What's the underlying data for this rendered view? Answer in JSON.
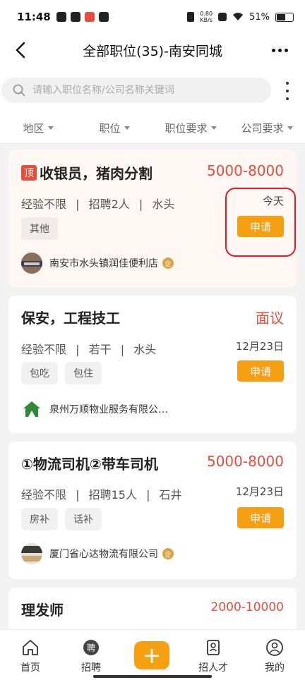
{
  "status_bar": {
    "time": "11:48",
    "net_speed_value": "0.80",
    "net_speed_unit": "KB/s",
    "battery": "51%",
    "battery_level": 0.51
  },
  "header": {
    "title": "全部职位(35)-南安同城"
  },
  "search": {
    "placeholder": "请输入职位名称/公司名称关键词"
  },
  "filters": [
    {
      "label": "地区"
    },
    {
      "label": "职位"
    },
    {
      "label": "职位要求"
    },
    {
      "label": "公司要求"
    }
  ],
  "jobs": [
    {
      "badge": "顶",
      "title": "收银员，猪肉分割",
      "salary": "5000-8000",
      "experience": "经验不限",
      "hiring": "招聘2人",
      "location": "水头",
      "date": "今天",
      "tags": [
        "其他"
      ],
      "apply_label": "申请",
      "company": "南安市水头镇润佳便利店",
      "certified_label": "企"
    },
    {
      "title": "保安，工程技工",
      "salary": "面议",
      "experience": "经验不限",
      "hiring": "若干",
      "location": "水头",
      "date": "12月23日",
      "tags": [
        "包吃",
        "包住"
      ],
      "apply_label": "申请",
      "company": "泉州万顺物业服务有限公…"
    },
    {
      "title": "①物流司机②带车司机",
      "salary": "5000-8000",
      "experience": "经验不限",
      "hiring": "招聘15人",
      "location": "石井",
      "date": "12月23日",
      "tags": [
        "房补",
        "话补"
      ],
      "apply_label": "申请",
      "company": "厦门省心达物流有限公司",
      "certified_label": "企"
    },
    {
      "title": "理发师",
      "salary": "2000-10000"
    }
  ],
  "separator": "|",
  "tabbar": [
    {
      "label": "首页",
      "icon": "home-icon"
    },
    {
      "label": "招聘",
      "icon": "recruit-icon",
      "icon_text": "聘"
    },
    {
      "label": "",
      "icon": "plus-icon",
      "icon_text": "+"
    },
    {
      "label": "招人才",
      "icon": "talent-icon"
    },
    {
      "label": "我的",
      "icon": "profile-icon"
    }
  ],
  "colors": {
    "accent": "#f5a012",
    "salary": "#e84c3d",
    "highlight": "#e31b23"
  }
}
